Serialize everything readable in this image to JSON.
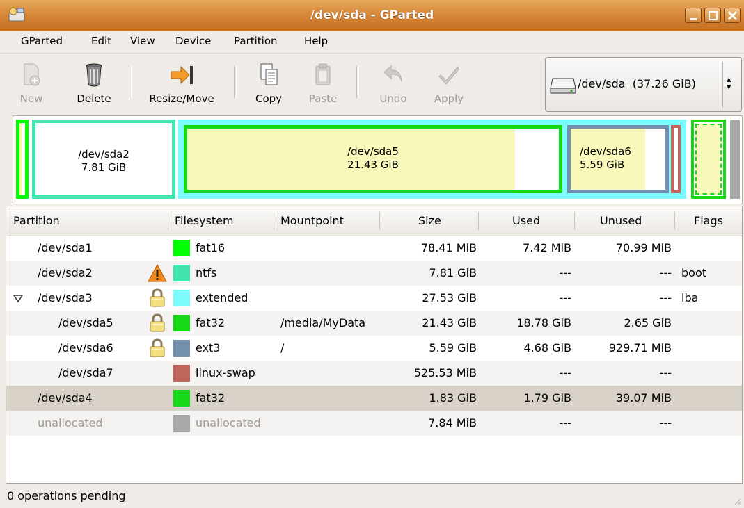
{
  "window": {
    "title": "/dev/sda - GParted",
    "titlebar_color": "#d9893a"
  },
  "menu": [
    {
      "label": "GParted"
    },
    {
      "label": "Edit"
    },
    {
      "label": "View"
    },
    {
      "label": "Device"
    },
    {
      "label": "Partition"
    },
    {
      "label": "Help"
    }
  ],
  "toolbar": {
    "new_label": "New",
    "delete_label": "Delete",
    "resize_label": "Resize/Move",
    "copy_label": "Copy",
    "paste_label": "Paste",
    "undo_label": "Undo",
    "apply_label": "Apply",
    "device_selected": "/dev/sda  (37.26 GiB)"
  },
  "diskmap": {
    "sda2": {
      "name": "/dev/sda2",
      "size": "7.81 GiB"
    },
    "sda5": {
      "name": "/dev/sda5",
      "size": "21.43 GiB"
    },
    "sda6": {
      "name": "/dev/sda6",
      "size": "5.59 GiB"
    }
  },
  "fs_colors": {
    "fat16": "#00ff00",
    "ntfs": "#42e5ac",
    "extended": "#7dfcfe",
    "fat32": "#18d918",
    "ext3": "#7590ae",
    "linux-swap": "#c1665a",
    "unallocated": "#a9a9a9",
    "used_fill": "#f8f8ba"
  },
  "table": {
    "headers": {
      "partition": "Partition",
      "filesystem": "Filesystem",
      "mountpoint": "Mountpoint",
      "size": "Size",
      "used": "Used",
      "unused": "Unused",
      "flags": "Flags"
    },
    "rows": [
      {
        "partition": "/dev/sda1",
        "filesystem": "fat16",
        "mountpoint": "",
        "size": "78.41 MiB",
        "used": "7.42 MiB",
        "unused": "70.99 MiB",
        "flags": "",
        "icon": ""
      },
      {
        "partition": "/dev/sda2",
        "filesystem": "ntfs",
        "mountpoint": "",
        "size": "7.81 GiB",
        "used": "---",
        "unused": "---",
        "flags": "boot",
        "icon": "warning-icon"
      },
      {
        "partition": "/dev/sda3",
        "filesystem": "extended",
        "mountpoint": "",
        "size": "27.53 GiB",
        "used": "---",
        "unused": "---",
        "flags": "lba",
        "icon": "lock-icon"
      },
      {
        "partition": "/dev/sda5",
        "filesystem": "fat32",
        "mountpoint": "/media/MyData",
        "size": "21.43 GiB",
        "used": "18.78 GiB",
        "unused": "2.65 GiB",
        "flags": "",
        "icon": "lock-icon"
      },
      {
        "partition": "/dev/sda6",
        "filesystem": "ext3",
        "mountpoint": "/",
        "size": "5.59 GiB",
        "used": "4.68 GiB",
        "unused": "929.71 MiB",
        "flags": "",
        "icon": "lock-icon"
      },
      {
        "partition": "/dev/sda7",
        "filesystem": "linux-swap",
        "mountpoint": "",
        "size": "525.53 MiB",
        "used": "---",
        "unused": "---",
        "flags": "",
        "icon": ""
      },
      {
        "partition": "/dev/sda4",
        "filesystem": "fat32",
        "mountpoint": "",
        "size": "1.83 GiB",
        "used": "1.79 GiB",
        "unused": "39.07 MiB",
        "flags": "",
        "icon": ""
      },
      {
        "partition": "unallocated",
        "filesystem": "unallocated",
        "mountpoint": "",
        "size": "7.84 MiB",
        "used": "---",
        "unused": "---",
        "flags": "",
        "icon": ""
      }
    ]
  },
  "status": {
    "text": "0 operations pending"
  }
}
